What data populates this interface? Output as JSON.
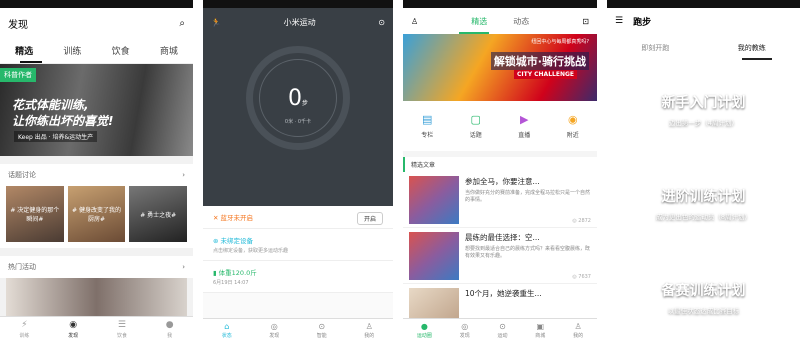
{
  "colors": {
    "keep_green": "#27b86b",
    "mi_teal": "#1fb9d8",
    "mi_orange": "#f5761f",
    "dark_header": "#393f45"
  },
  "panel1": {
    "title": "发现",
    "tabs": [
      "精选",
      "训练",
      "饮食",
      "商城"
    ],
    "banner": {
      "tag": "科普作者",
      "line1": "花式体能训练,",
      "line2": "让你练出坏的喜觉!",
      "sub": "Keep 出品 · 培养&运动生产"
    },
    "topics_header": "话题讨论",
    "topics": [
      "# 决定健身的那个瞬间#",
      "# 健身改变了我的厨房#",
      "# 勇士之夜#"
    ],
    "hot_header": "热门活动",
    "nav": [
      "训练",
      "发现",
      "饮食",
      "我"
    ]
  },
  "panel2": {
    "title": "小米运动",
    "steps": "0",
    "steps_unit": "步",
    "steps_sub": "0米 · 0千卡",
    "bluetooth": {
      "title": "蓝牙未开启",
      "button": "开启"
    },
    "device": {
      "title": "未绑定设备",
      "sub": "点击绑定设备，获取更多运动乐趣"
    },
    "weight": {
      "title": "体重120.0斤",
      "sub": "6月19日 14:07"
    },
    "nav": [
      "状态",
      "发现",
      "智能",
      "我的"
    ]
  },
  "panel3": {
    "tabs": [
      "精选",
      "动态"
    ],
    "banner": {
      "top": "纽回中心与每周都真秀吗?",
      "title": "解锁城市·骑行挑战",
      "sub": "CITY CHALLENGE"
    },
    "icons": [
      "专栏",
      "话题",
      "直播",
      "附近"
    ],
    "featured_label": "精选文章",
    "articles": [
      {
        "title": "参加全马，你要注意...",
        "summary": "当你做好充分的赛前准备，完成全程马拉松只是一个自然的事情。",
        "views": "2872"
      },
      {
        "title": "晨练的最佳选择：空...",
        "summary": "想要找到最适合自己的晨练方式吗？来看看空腹晨练，既有效果又有乐趣。",
        "views": "7637"
      },
      {
        "title": "10个月，她逆袭重生...",
        "summary": "",
        "views": ""
      }
    ],
    "nav": [
      "运动圈",
      "发现",
      "运动",
      "商城",
      "我的"
    ]
  },
  "panel4": {
    "title": "跑步",
    "tabs": [
      "即刻开跑",
      "我的教练"
    ],
    "cards": [
      {
        "title": "新手入门计划",
        "sub": "迈出第一步（4周计划）"
      },
      {
        "title": "进阶训练计划",
        "sub": "成为更出色的运动员（8周计划）"
      },
      {
        "title": "备赛训练计划",
        "sub": "以最佳状态达成比赛目标"
      }
    ]
  }
}
